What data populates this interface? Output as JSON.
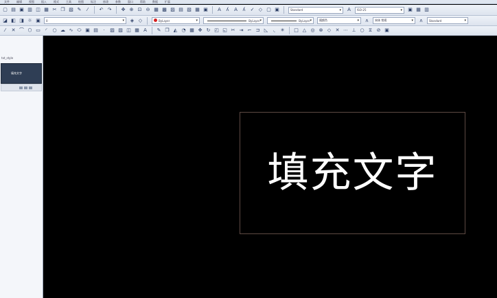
{
  "menu": {
    "items": [
      "文件",
      "编辑",
      "视图",
      "插入",
      "格式",
      "工具",
      "绘图",
      "标注",
      "修改",
      "参数",
      "窗口",
      "帮助",
      "数据",
      "扩展"
    ]
  },
  "toolbar": {
    "text_style_combo": "Standard",
    "dim_style_combo": "ISO-25",
    "color_combo": "ByLayer",
    "linetype_combo": "ByLayer",
    "lineweight_combo": "ByLayer",
    "plot_style_combo": "随颜色",
    "layer_combo": "0",
    "font_combo": "宋体 常规",
    "annot_combo": "Standard"
  },
  "left_panel": {
    "title": "txt_style",
    "card_label": "填充文字"
  },
  "canvas": {
    "text": "填充文字"
  },
  "colors": {
    "canvas_bg": "#000000",
    "frame": "#5e4a44",
    "toolbar_bg": "#e6ebf3",
    "panel_card": "#2f3e55"
  }
}
